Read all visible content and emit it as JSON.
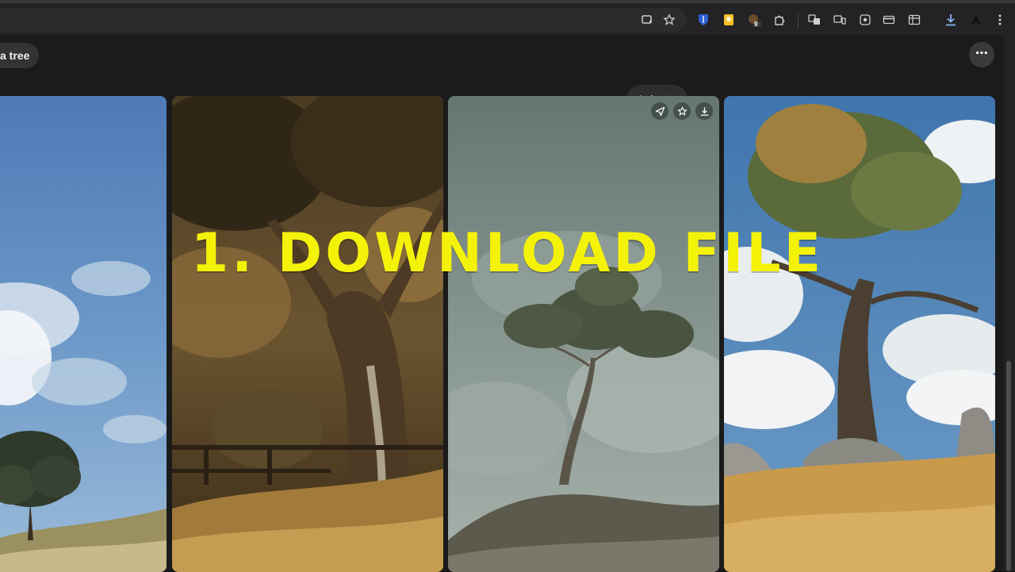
{
  "browser": {
    "icons": [
      "cast-icon",
      "bookmark-star-icon",
      "bitwarden-icon",
      "keep-icon",
      "extension-badge-icon",
      "puzzle-icon",
      "translate-icon",
      "devices-icon",
      "screenshot-icon",
      "card-icon",
      "sidepanel-icon",
      "download-icon",
      "profile-icon",
      "menu-icon"
    ],
    "extension_badge_count": "9"
  },
  "header": {
    "prompt_chip": "a tree",
    "more_label": "⋯",
    "animate_label": "Animate"
  },
  "cards": [
    {
      "name": "tree-image-1",
      "description_icon": "image"
    },
    {
      "name": "tree-image-2",
      "description_icon": "image"
    },
    {
      "name": "tree-image-3",
      "description_icon": "image",
      "actions": [
        "share-icon",
        "favorite-icon",
        "download-icon"
      ]
    },
    {
      "name": "tree-image-4",
      "description_icon": "image"
    }
  ],
  "overlay": {
    "caption": "1. DOWNLOAD FILE",
    "color": "#f5f20a"
  },
  "colors": {
    "background": "#1b1b1b",
    "toolbar": "#232325",
    "accent_yellow": "#f5f20a",
    "download_blue": "#8ab4f8"
  }
}
